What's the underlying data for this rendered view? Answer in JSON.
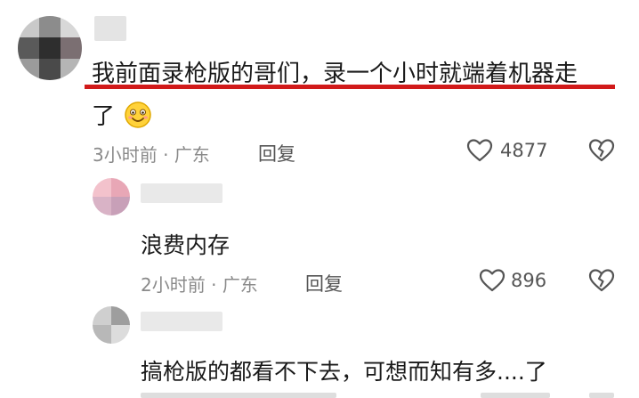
{
  "comments": [
    {
      "text_line1": "我前面录枪版的哥们，录一个小时就端着机器走",
      "text_line2": "了",
      "emoji": "smiling-face-emoji",
      "time": "3小时前",
      "location": "广东",
      "reply_label": "回复",
      "likes": "4877"
    },
    {
      "text_line1": "浪费内存",
      "time": "2小时前",
      "location": "广东",
      "reply_label": "回复",
      "likes": "896"
    },
    {
      "text_line1": "搞枪版的都看不下去，可想而知有多....了"
    }
  ],
  "meta_separator": "·",
  "colors": {
    "highlight_underline": "#d11a1a",
    "meta_text": "#8a8a8a"
  },
  "icons": [
    "heart-icon",
    "broken-heart-icon"
  ]
}
